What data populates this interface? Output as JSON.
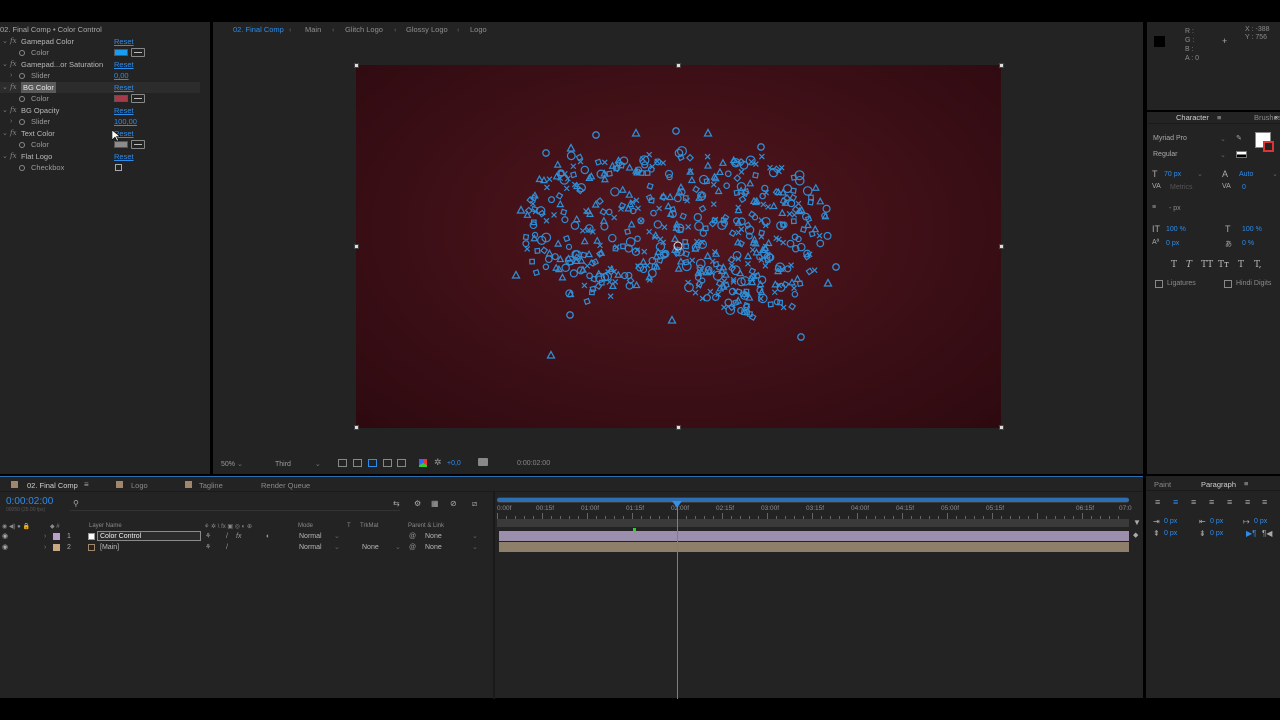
{
  "effect_controls": {
    "header": "02. Final Comp • Color Control",
    "effects": [
      {
        "name": "Gamepad Color",
        "reset": "Reset",
        "selected": false,
        "sub": {
          "label": "Color",
          "kind": "color",
          "swatch": "#1a9df0"
        }
      },
      {
        "name": "Gamepad...or Saturation",
        "reset": "Reset",
        "selected": false,
        "sub": {
          "label": "Slider",
          "kind": "value",
          "value": "0,00"
        }
      },
      {
        "name": "BG Color",
        "reset": "Reset",
        "selected": true,
        "sub": {
          "label": "Color",
          "kind": "color",
          "swatch": "#a63a48"
        }
      },
      {
        "name": "BG Opacity",
        "reset": "Reset",
        "selected": false,
        "sub": {
          "label": "Slider",
          "kind": "value",
          "value": "100,00"
        }
      },
      {
        "name": "Text Color",
        "reset": "Reset",
        "selected": false,
        "sub": {
          "label": "Color",
          "kind": "color",
          "swatch": "#8c8c8c"
        }
      },
      {
        "name": "Flat Logo",
        "reset": "Reset",
        "selected": false,
        "sub": {
          "label": "Checkbox",
          "kind": "checkbox"
        }
      }
    ]
  },
  "viewer": {
    "breadcrumbs": [
      "02. Final Comp",
      "Main",
      "Glitch Logo",
      "Glossy Logo",
      "Logo"
    ],
    "zoom": "50%",
    "view": "Third",
    "exposure": "+0,0",
    "timecode": "0:00:02:00",
    "bg_color": "#3d0f16",
    "accent": "#2d8ceb"
  },
  "info_panel": {
    "r": "R :",
    "g": "G :",
    "b": "B :",
    "a": "A : 0",
    "x": "X : -388",
    "y": "Y : 756"
  },
  "character": {
    "tabs": [
      "Character",
      "Brushes"
    ],
    "font": "Myriad Pro",
    "style": "Regular",
    "size": "70 px",
    "leading": "Auto",
    "kerning": "Metrics",
    "tracking": "0",
    "stroke": "- px",
    "vscale": "100 %",
    "hscale": "100 %",
    "baseline": "0 px",
    "tsume": "0 %",
    "style_buttons": [
      "T",
      "T",
      "TT",
      "Tт",
      "T",
      "T,"
    ],
    "ligatures": "Ligatures",
    "hindi_digits": "Hindi Digits"
  },
  "timeline": {
    "tabs": [
      {
        "label": "02. Final Comp",
        "color": "#a0866a",
        "active": true
      },
      {
        "label": "Logo",
        "color": "#a0866a",
        "active": false
      },
      {
        "label": "Tagline",
        "color": "#a0866a",
        "active": false
      },
      {
        "label": "Render Queue",
        "color": "",
        "active": false
      }
    ],
    "current_time": "0:00:02:00",
    "frame_info": "00050 (25.00 fps)",
    "columns": {
      "layer_name": "Layer Name",
      "mode": "Mode",
      "t": "T",
      "trkmat": "TrkMat",
      "parent": "Parent & Link"
    },
    "layers": [
      {
        "num": "1",
        "name": "Color Control",
        "color": "#b8a0c8",
        "mode": "Normal",
        "trkmat": "",
        "parent": "None",
        "selected": true,
        "bar_color": "#9c8fae"
      },
      {
        "num": "2",
        "name": "[Main]",
        "color": "#c8a882",
        "mode": "Normal",
        "trkmat": "None",
        "parent": "None",
        "selected": false,
        "bar_color": "#8e7f6a"
      }
    ],
    "ruler": [
      "0:00f",
      "00:15f",
      "01:00f",
      "01:15f",
      "02:00f",
      "02:15f",
      "03:00f",
      "03:15f",
      "04:00f",
      "04:15f",
      "05:00f",
      "05:15f",
      "06:15f",
      "07:0"
    ],
    "playhead_seconds": 2
  },
  "paragraph": {
    "tabs": [
      "Paint",
      "Paragraph"
    ],
    "indent_values": [
      "0 px",
      "0 px",
      "0 px",
      "0 px",
      "0 px"
    ]
  }
}
